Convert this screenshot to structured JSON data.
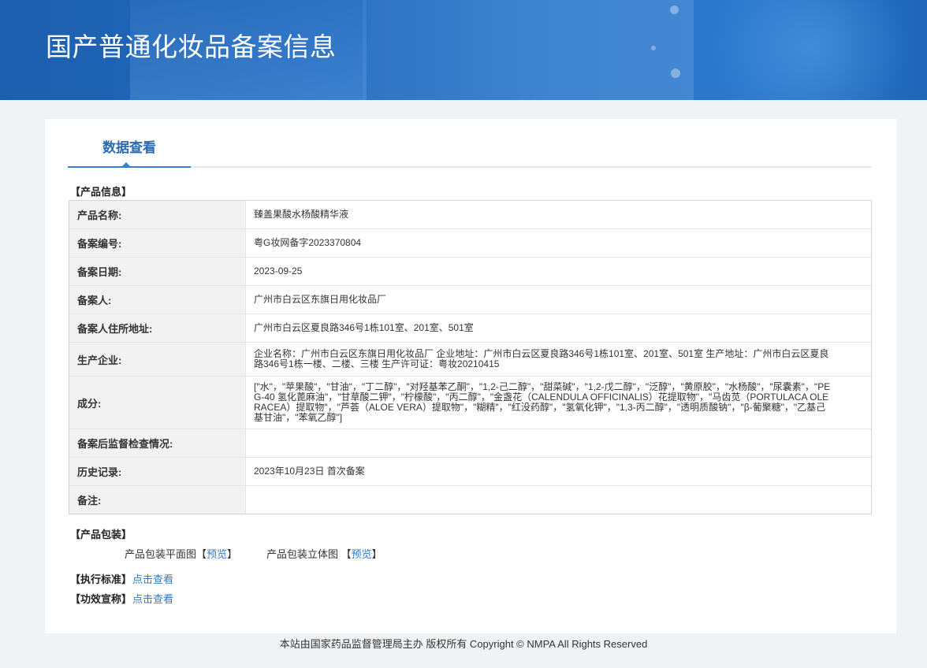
{
  "theme": {
    "header_start": "#1c5fae",
    "header_end": "#2b78cc",
    "accent": "#2a6ab2",
    "link": "#3478c0",
    "page_bg": "#f0f3f6"
  },
  "header": {
    "title": "国产普通化妆品备案信息"
  },
  "tabs": [
    {
      "label": "数据查看",
      "active": true
    }
  ],
  "product_info": {
    "section_title": "【产品信息】",
    "rows": [
      {
        "label": "产品名称:",
        "value": "臻盖果酸水杨酸精华液"
      },
      {
        "label": "备案编号:",
        "value": "粤G妆网备字2023370804"
      },
      {
        "label": "备案日期:",
        "value": "2023-09-25"
      },
      {
        "label": "备案人:",
        "value": "广州市白云区东旗日用化妆品厂"
      },
      {
        "label": "备案人住所地址:",
        "value": "广州市白云区夏良路346号1栋101室、201室、501室"
      },
      {
        "label": "生产企业:",
        "value": "企业名称：广州市白云区东旗日用化妆品厂 企业地址：广州市白云区夏良路346号1栋101室、201室、501室 生产地址：广州市白云区夏良路346号1栋一楼、二楼、三楼 生产许可证：粤妆20210415"
      },
      {
        "label": "成分:",
        "value": "[\"水\"，\"苹果酸\"，\"甘油\"，\"丁二醇\"，\"对羟基苯乙酮\"，\"1,2-己二醇\"，\"甜菜碱\"，\"1,2-戊二醇\"，\"泛醇\"，\"黄原胶\"，\"水杨酸\"，\"尿囊素\"，\"PEG-40 氢化蓖麻油\"，\"甘草酸二钾\"，\"柠檬酸\"，\"丙二醇\"，\"金盏花（CALENDULA OFFICINALIS）花提取物\"，\"马齿苋（PORTULACA OLERACEA）提取物\"，\"芦荟（ALOE VERA）提取物\"，\"糊精\"，\"红没药醇\"，\"氢氧化钾\"，\"1,3-丙二醇\"，\"透明质酸钠\"，\"β-葡聚糖\"，\"乙基己基甘油\"，\"苯氧乙醇\"]"
      },
      {
        "label": "备案后监督检查情况:",
        "value": ""
      },
      {
        "label": "历史记录:",
        "value": "2023年10月23日 首次备案"
      },
      {
        "label": "备注:",
        "value": ""
      }
    ]
  },
  "packaging": {
    "section_title": "【产品包装】",
    "items": [
      {
        "label": "产品包装平面图",
        "open": "【",
        "link": "预览",
        "close": "】"
      },
      {
        "label": "产品包装立体图 ",
        "open": "【",
        "link": "预览",
        "close": "】"
      }
    ]
  },
  "standard": {
    "title": "【执行标准】",
    "link": "点击查看"
  },
  "claims": {
    "title": "【功效宣称】",
    "link": "点击查看"
  },
  "footer": {
    "text": "本站由国家药品监督管理局主办 版权所有 Copyright © NMPA All Rights Reserved"
  }
}
